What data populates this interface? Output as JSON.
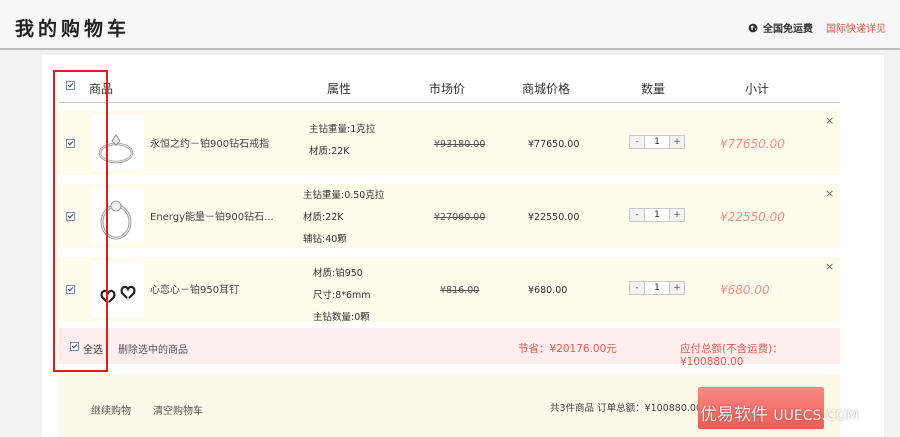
{
  "header": {
    "title": "我的购物车",
    "free_shipping": "全国免运费",
    "intl_shipping": "国际快递详见"
  },
  "table_header": {
    "product": "商品",
    "attributes": "属性",
    "market_price": "市场价",
    "mall_price": "商城价格",
    "quantity": "数量",
    "subtotal": "小计",
    "select_all_checked": true
  },
  "items": [
    {
      "checked": true,
      "name": "永恒之约－铂900钻石戒指",
      "attributes": [
        "主钻重量:1克拉",
        "材质:22K"
      ],
      "market_price": "¥93180.00",
      "mall_price": "¥77650.00",
      "quantity": "1",
      "subtotal": "¥77650.00",
      "thumb_icon": "ring-icon"
    },
    {
      "checked": true,
      "name": "Energy能量－铂900钻石...",
      "attributes": [
        "主钻重量:0.50克拉",
        "材质:22K",
        "辅钻:40颗"
      ],
      "market_price": "¥27060.00",
      "mall_price": "¥22550.00",
      "quantity": "1",
      "subtotal": "¥22550.00",
      "thumb_icon": "ring-icon"
    },
    {
      "checked": true,
      "name": "心恋心－铂950耳钉",
      "attributes": [
        "材质:铂950",
        "尺寸:8*6mm",
        "主钻数量:0颗"
      ],
      "market_price": "¥816.00",
      "mall_price": "¥680.00",
      "quantity": "1",
      "subtotal": "¥680.00",
      "thumb_icon": "earrings-icon"
    }
  ],
  "qty_controls": {
    "minus": "-",
    "plus": "+"
  },
  "remove_symbol": "×",
  "summary": {
    "select_all": "全选",
    "delete_selected": "删除选中的商品",
    "savings": "节省：¥20176.00元",
    "total": "应付总额(不含运费)：¥100880.00"
  },
  "bottom": {
    "continue_shopping": "继续购物",
    "clear_cart": "清空购物车",
    "order_summary": "共3件商品  订单总额：¥100880.00"
  },
  "watermark": {
    "text": "优易软件",
    "suffix": "UUECS.COM"
  },
  "colors": {
    "accent_red": "#e05a54",
    "row_bg": "#fefbea",
    "summary_bg": "#fdeeed",
    "highlight_border": "#e41b1b"
  }
}
